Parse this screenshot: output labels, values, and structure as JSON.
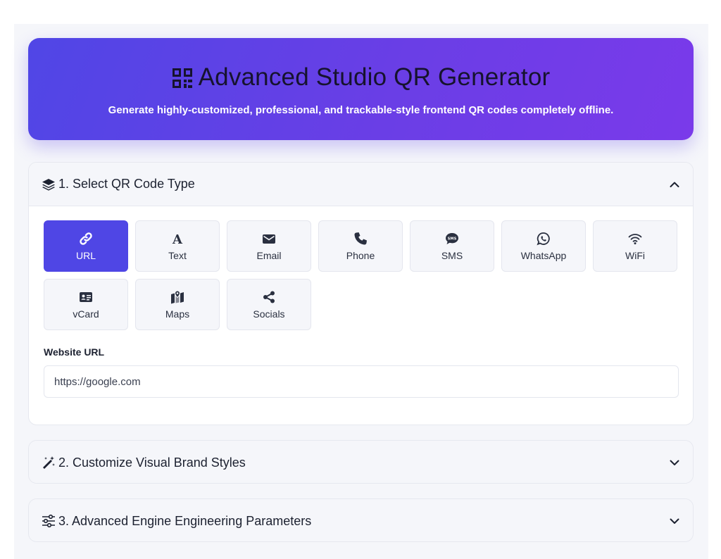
{
  "hero": {
    "title": "Advanced Studio QR Generator",
    "subtitle": "Generate highly-customized, professional, and trackable-style frontend QR codes completely offline.",
    "icon": "qrcode-icon"
  },
  "sections": [
    {
      "title": "1. Select QR Code Type",
      "icon": "layers-icon",
      "expanded": true
    },
    {
      "title": "2. Customize Visual Brand Styles",
      "icon": "magic-wand-icon",
      "expanded": false
    },
    {
      "title": "3. Advanced Engine Engineering Parameters",
      "icon": "sliders-icon",
      "expanded": false
    }
  ],
  "types": [
    {
      "label": "URL",
      "icon": "link-icon",
      "active": true
    },
    {
      "label": "Text",
      "icon": "font-icon",
      "active": false
    },
    {
      "label": "Email",
      "icon": "envelope-icon",
      "active": false
    },
    {
      "label": "Phone",
      "icon": "phone-icon",
      "active": false
    },
    {
      "label": "SMS",
      "icon": "sms-icon",
      "active": false
    },
    {
      "label": "WhatsApp",
      "icon": "whatsapp-icon",
      "active": false
    },
    {
      "label": "WiFi",
      "icon": "wifi-icon",
      "active": false
    },
    {
      "label": "vCard",
      "icon": "id-card-icon",
      "active": false
    },
    {
      "label": "Maps",
      "icon": "map-pin-icon",
      "active": false
    },
    {
      "label": "Socials",
      "icon": "share-icon",
      "active": false
    }
  ],
  "url_field": {
    "label": "Website URL",
    "value": "https://google.com"
  },
  "colors": {
    "accent": "#4f46e5",
    "hero_start": "#5046e6",
    "hero_end": "#7a3aea"
  }
}
